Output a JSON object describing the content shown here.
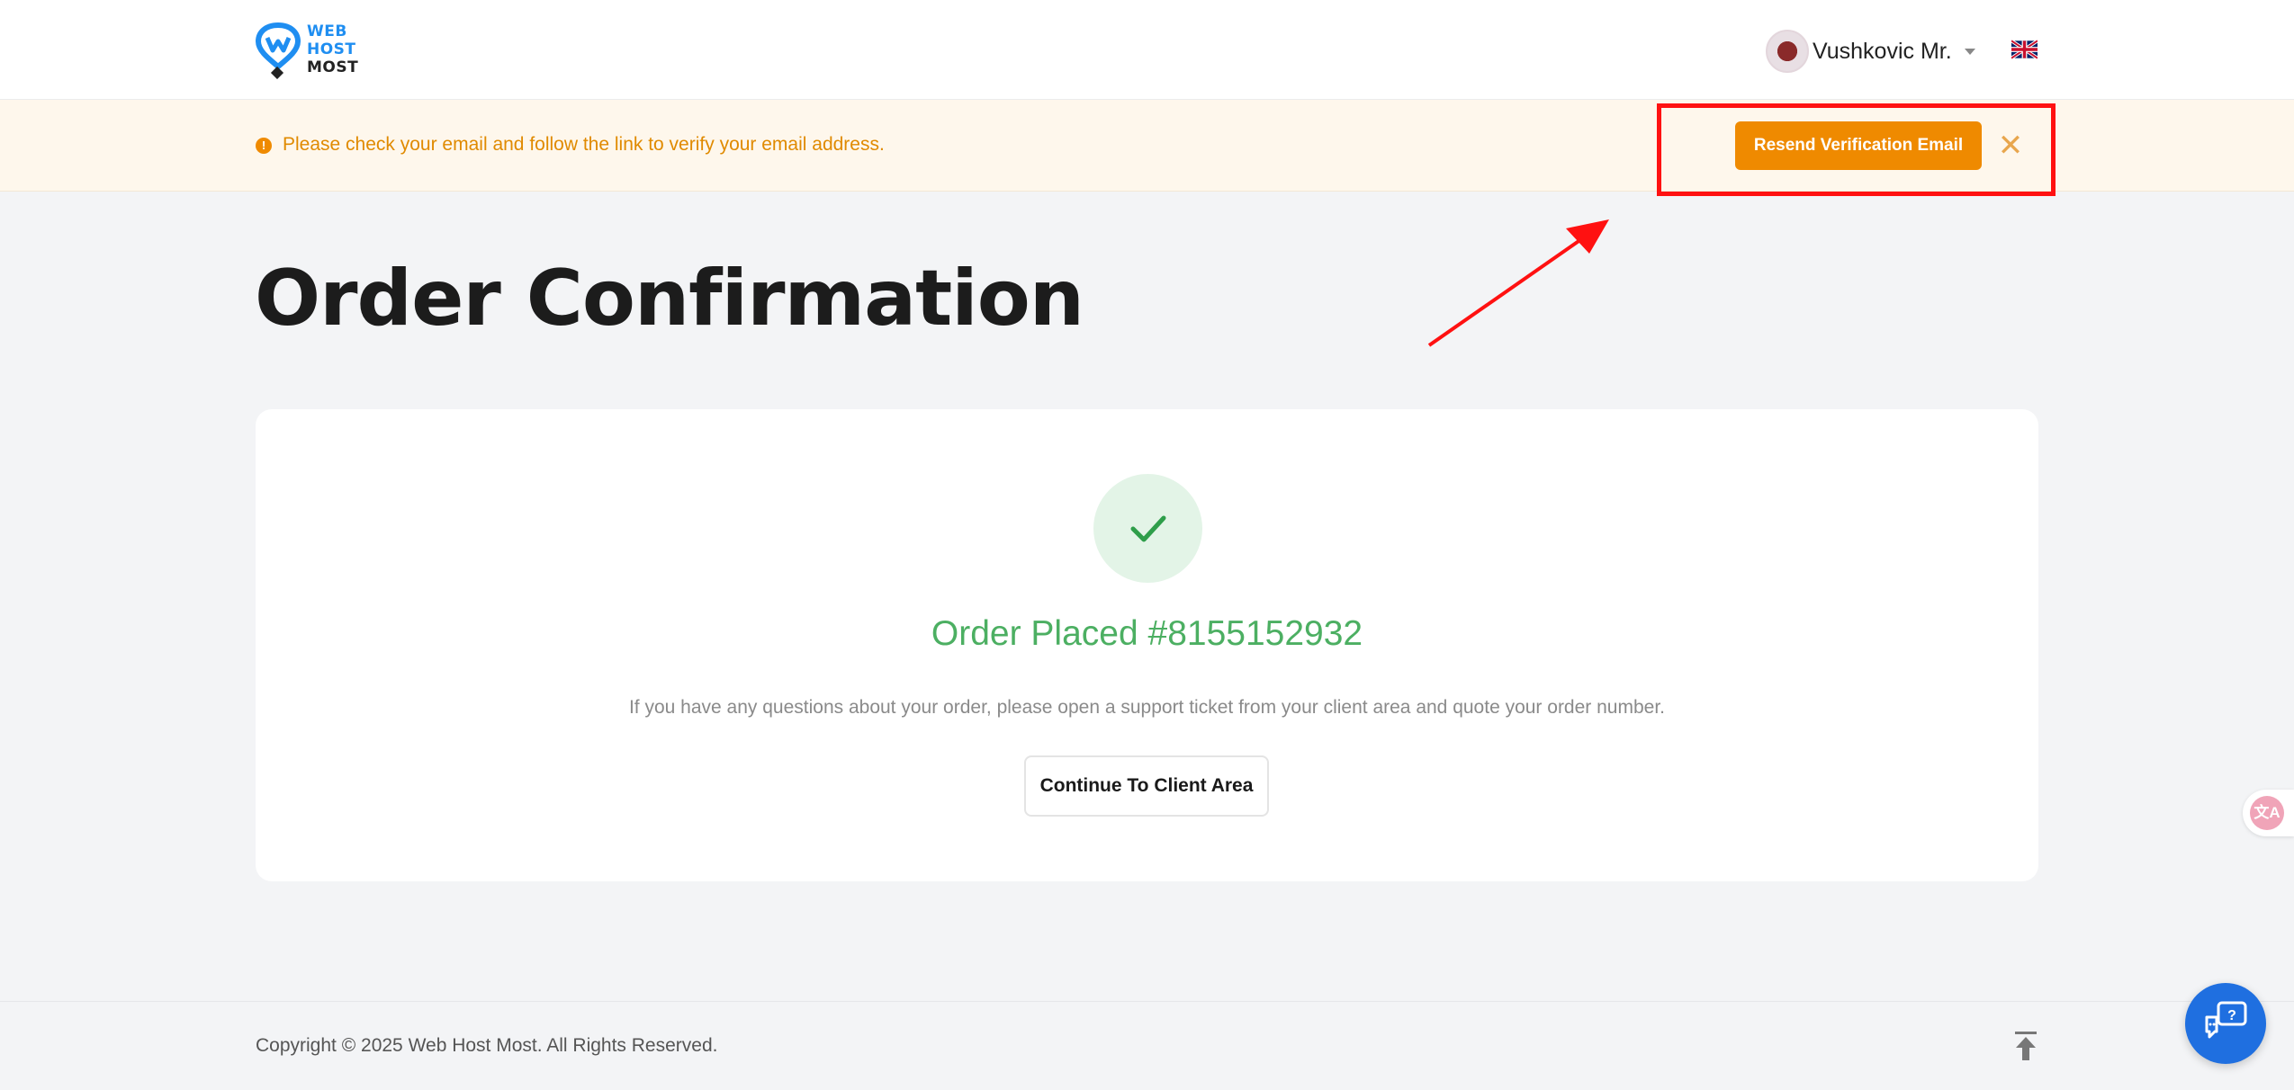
{
  "header": {
    "logo": {
      "line1": "WEB",
      "line2": "HOST",
      "line3": "MOST",
      "brand_color": "#1f8ef1"
    },
    "user": {
      "name": "Vushkovic Mr.",
      "avatar_icon": "user-avatar"
    },
    "language_flag": "uk-flag-icon"
  },
  "alert": {
    "message": "Please check your email and follow the link to verify your email address.",
    "resend_label": "Resend Verification Email",
    "close_label": "✕",
    "accent": "#ef8a00"
  },
  "page": {
    "title": "Order Confirmation"
  },
  "order": {
    "placed_text": "Order Placed #8155152932",
    "note": "If you have any questions about your order, please open a support ticket from your client area and quote your order number.",
    "continue_label": "Continue To Client Area",
    "success_color": "#4caf62"
  },
  "translate_widget": {
    "glyph": "文A"
  },
  "footer": {
    "copyright": "Copyright © 2025 Web Host Most. All Rights Reserved."
  },
  "annotation_color": "#ff1111"
}
